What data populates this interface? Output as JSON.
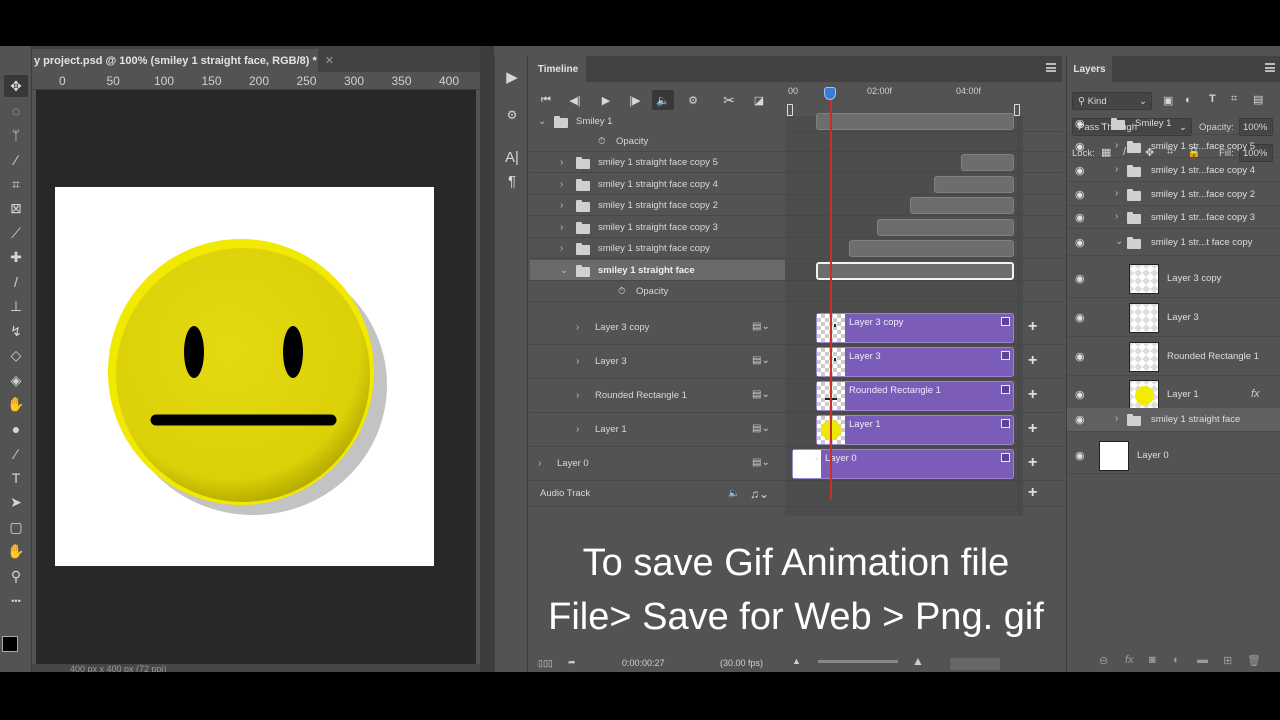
{
  "document": {
    "tab_title": "y project.psd @ 100% (smiley 1 straight face, RGB/8) *",
    "ruler_ticks": [
      "0",
      "50",
      "100",
      "150",
      "200",
      "250",
      "300",
      "350",
      "400"
    ],
    "status": "400 px x 400 px (72 ppi)"
  },
  "tools": [
    {
      "name": "move-tool",
      "glyph": "✥"
    },
    {
      "name": "marquee-tool",
      "glyph": "◌"
    },
    {
      "name": "lasso-tool",
      "glyph": "ᛘ"
    },
    {
      "name": "magic-wand-tool",
      "glyph": "⁄"
    },
    {
      "name": "crop-tool",
      "glyph": "⌗"
    },
    {
      "name": "frame-tool",
      "glyph": "⊠"
    },
    {
      "name": "eyedropper-tool",
      "glyph": "⟋"
    },
    {
      "name": "healing-brush-tool",
      "glyph": "✚"
    },
    {
      "name": "brush-tool",
      "glyph": "/"
    },
    {
      "name": "clone-stamp-tool",
      "glyph": "⊥"
    },
    {
      "name": "history-brush-tool",
      "glyph": "↯"
    },
    {
      "name": "eraser-tool",
      "glyph": "◇"
    },
    {
      "name": "paint-bucket-tool",
      "glyph": "◈"
    },
    {
      "name": "blur-tool",
      "glyph": "✋"
    },
    {
      "name": "dodge-tool",
      "glyph": "●"
    },
    {
      "name": "pen-tool",
      "glyph": "∕"
    },
    {
      "name": "type-tool",
      "glyph": "T"
    },
    {
      "name": "path-selection-tool",
      "glyph": "➤"
    },
    {
      "name": "shape-tool",
      "glyph": "▢"
    },
    {
      "name": "hand-tool",
      "glyph": "✋"
    },
    {
      "name": "zoom-tool",
      "glyph": "⚲"
    },
    {
      "name": "more-tools",
      "glyph": "•••"
    }
  ],
  "timeline": {
    "tab_label": "Timeline",
    "time_labels": [
      "00",
      "02:00f",
      "04:00f"
    ],
    "tracks": [
      {
        "label": "Smiley 1",
        "type": "group",
        "level": 0,
        "expanded": true
      },
      {
        "label": "Opacity",
        "type": "property",
        "level": 1
      },
      {
        "label": "smiley 1 straight face copy 5",
        "type": "group",
        "level": 1
      },
      {
        "label": "smiley 1 straight face copy 4",
        "type": "group",
        "level": 1
      },
      {
        "label": "smiley 1 straight face copy 2",
        "type": "group",
        "level": 1
      },
      {
        "label": "smiley 1 straight face copy 3",
        "type": "group",
        "level": 1
      },
      {
        "label": "smiley 1 straight face copy",
        "type": "group",
        "level": 1
      },
      {
        "label": "smiley 1 straight face",
        "type": "group",
        "level": 1,
        "selected": true,
        "expanded": true
      },
      {
        "label": "Opacity",
        "type": "property",
        "level": 2
      }
    ],
    "layer_tracks": [
      {
        "label": "Layer 3 copy",
        "clip": "Layer 3 copy"
      },
      {
        "label": "Layer 3",
        "clip": "Layer 3"
      },
      {
        "label": "Rounded Rectangle 1",
        "clip": "Rounded Rectangle 1"
      },
      {
        "label": "Layer 1",
        "clip": "Layer 1"
      },
      {
        "label": "Layer 0",
        "clip": "Layer 0"
      }
    ],
    "audio_track_label": "Audio Track",
    "current_time": "0:00:00:27",
    "fps": "(30.00 fps)"
  },
  "caption": {
    "line1": "To save Gif Animation file",
    "line2": "File> Save for Web > Png. gif"
  },
  "layers": {
    "tab_label": "Layers",
    "filter_kind": "Kind",
    "blend_mode": "Pass Through",
    "opacity_label": "Opacity:",
    "opacity_value": "100%",
    "lock_label": "Lock:",
    "fill_label": "Fill:",
    "fill_value": "100%",
    "items": [
      {
        "name": "Smiley 1",
        "type": "group"
      },
      {
        "name": "smiley 1 str...face copy 5",
        "type": "group"
      },
      {
        "name": "smiley 1 str...face copy 4",
        "type": "group"
      },
      {
        "name": "smiley 1 str...face copy 2",
        "type": "group"
      },
      {
        "name": "smiley 1 str...face copy 3",
        "type": "group"
      },
      {
        "name": "smiley 1 str...t face copy",
        "type": "group"
      },
      {
        "name": "Layer 3 copy",
        "type": "layer"
      },
      {
        "name": "Layer 3",
        "type": "layer"
      },
      {
        "name": "Rounded Rectangle 1",
        "type": "layer"
      },
      {
        "name": "Layer 1",
        "type": "layer",
        "fx": "fx"
      },
      {
        "name": "smiley 1 straight face",
        "type": "group"
      },
      {
        "name": "Layer 0",
        "type": "layer"
      }
    ]
  },
  "colors": {
    "clip_purple": "#7b5cb8",
    "playhead_red": "#c8302c",
    "playhead_blue": "#3a7bd5",
    "smiley_yellow": "#e3d90a"
  }
}
